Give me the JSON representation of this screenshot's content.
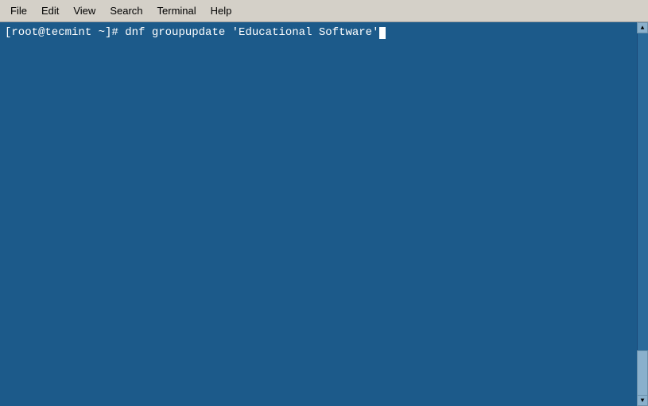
{
  "menubar": {
    "items": [
      {
        "id": "file",
        "label": "File"
      },
      {
        "id": "edit",
        "label": "Edit"
      },
      {
        "id": "view",
        "label": "View"
      },
      {
        "id": "search",
        "label": "Search"
      },
      {
        "id": "terminal",
        "label": "Terminal"
      },
      {
        "id": "help",
        "label": "Help"
      }
    ]
  },
  "terminal": {
    "prompt": "[root@tecmint ~]# ",
    "command": "dnf groupupdate 'Educational Software'",
    "background_color": "#1c5a8a",
    "text_color": "#ffffff"
  }
}
